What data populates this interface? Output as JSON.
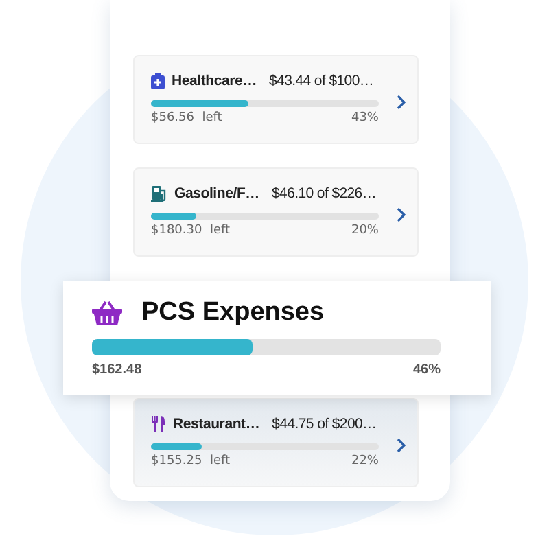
{
  "categories": [
    {
      "kind": "healthcare",
      "color": "#3d4fd1",
      "name": "Healthcare…",
      "amount": "$43.44 of $100…",
      "left": "$56.56  left",
      "percent": "43%",
      "level": 0.43
    },
    {
      "kind": "fuel",
      "color": "#1f6f78",
      "name": "Gasoline/F…",
      "amount": "$46.10 of $226…",
      "left": "$180.30  left",
      "percent": "20%",
      "level": 0.2
    },
    {
      "kind": "restaurant",
      "color": "#7b2fb8",
      "name": "Restaurant…",
      "amount": "$44.75 of $200…",
      "left": "$155.25  left",
      "percent": "22%",
      "level": 0.22
    }
  ],
  "highlight": {
    "kind": "basket",
    "color": "#8e2ac4",
    "title": "PCS Expenses",
    "amount": "$162.48",
    "percent": "46%",
    "level": 0.46
  }
}
